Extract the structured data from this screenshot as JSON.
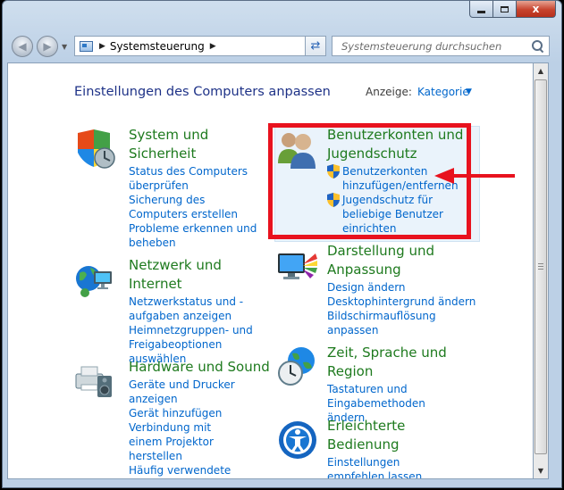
{
  "window": {
    "buttons": {
      "minimize": "",
      "maximize": "",
      "close": "x"
    }
  },
  "nav": {
    "back_icon": "arrow-left-icon",
    "forward_icon": "arrow-right-icon",
    "address_path": "Systemsteuerung",
    "search_placeholder": "Systemsteuerung durchsuchen"
  },
  "header": {
    "title": "Einstellungen des Computers anpassen",
    "view_label": "Anzeige:",
    "view_value": "Kategorie"
  },
  "categories": {
    "system": {
      "title": "System und Sicherheit",
      "links": [
        "Status des Computers überprüfen",
        "Sicherung des Computers erstellen",
        "Probleme erkennen und beheben"
      ]
    },
    "network": {
      "title": "Netzwerk und Internet",
      "links": [
        "Netzwerkstatus und -aufgaben anzeigen",
        "Heimnetzgruppen- und Freigabeoptionen auswählen"
      ]
    },
    "hardware": {
      "title": "Hardware und Sound",
      "links": [
        "Geräte und Drucker anzeigen",
        "Gerät hinzufügen",
        "Verbindung mit einem Projektor herstellen",
        "Häufig verwendete Mobilitätseinstellungen ändern"
      ]
    },
    "users": {
      "title": "Benutzerkonten und Jugendschutz",
      "links": [
        "Benutzerkonten hinzufügen/entfernen",
        "Jugendschutz für beliebige Benutzer einrichten"
      ]
    },
    "appearance": {
      "title": "Darstellung und Anpassung",
      "links": [
        "Design ändern",
        "Desktophintergrund ändern",
        "Bildschirmauflösung anpassen"
      ]
    },
    "clock": {
      "title": "Zeit, Sprache und Region",
      "links": [
        "Tastaturen und Eingabemethoden ändern"
      ]
    },
    "ease": {
      "title": "Erleichterte Bedienung",
      "links": [
        "Einstellungen empfehlen lassen"
      ]
    }
  },
  "colors": {
    "category_title": "#1e7a1e",
    "link": "#0066cc",
    "highlight_frame": "#e8121e"
  }
}
